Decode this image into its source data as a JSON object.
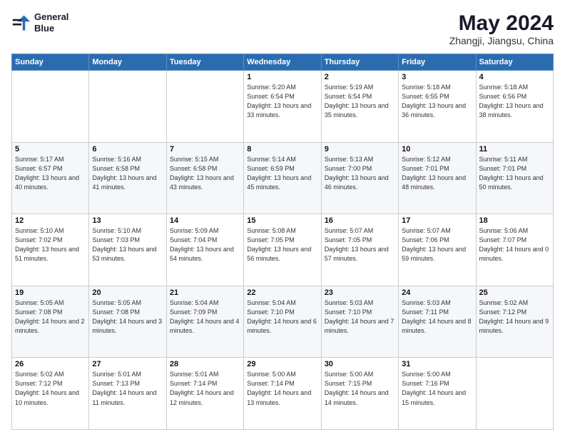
{
  "header": {
    "logo_line1": "General",
    "logo_line2": "Blue",
    "title": "May 2024",
    "subtitle": "Zhangji, Jiangsu, China"
  },
  "days_of_week": [
    "Sunday",
    "Monday",
    "Tuesday",
    "Wednesday",
    "Thursday",
    "Friday",
    "Saturday"
  ],
  "weeks": [
    [
      {
        "day": "",
        "info": ""
      },
      {
        "day": "",
        "info": ""
      },
      {
        "day": "",
        "info": ""
      },
      {
        "day": "1",
        "info": "Sunrise: 5:20 AM\nSunset: 6:54 PM\nDaylight: 13 hours and 33 minutes."
      },
      {
        "day": "2",
        "info": "Sunrise: 5:19 AM\nSunset: 6:54 PM\nDaylight: 13 hours and 35 minutes."
      },
      {
        "day": "3",
        "info": "Sunrise: 5:18 AM\nSunset: 6:55 PM\nDaylight: 13 hours and 36 minutes."
      },
      {
        "day": "4",
        "info": "Sunrise: 5:18 AM\nSunset: 6:56 PM\nDaylight: 13 hours and 38 minutes."
      }
    ],
    [
      {
        "day": "5",
        "info": "Sunrise: 5:17 AM\nSunset: 6:57 PM\nDaylight: 13 hours and 40 minutes."
      },
      {
        "day": "6",
        "info": "Sunrise: 5:16 AM\nSunset: 6:58 PM\nDaylight: 13 hours and 41 minutes."
      },
      {
        "day": "7",
        "info": "Sunrise: 5:15 AM\nSunset: 6:58 PM\nDaylight: 13 hours and 43 minutes."
      },
      {
        "day": "8",
        "info": "Sunrise: 5:14 AM\nSunset: 6:59 PM\nDaylight: 13 hours and 45 minutes."
      },
      {
        "day": "9",
        "info": "Sunrise: 5:13 AM\nSunset: 7:00 PM\nDaylight: 13 hours and 46 minutes."
      },
      {
        "day": "10",
        "info": "Sunrise: 5:12 AM\nSunset: 7:01 PM\nDaylight: 13 hours and 48 minutes."
      },
      {
        "day": "11",
        "info": "Sunrise: 5:11 AM\nSunset: 7:01 PM\nDaylight: 13 hours and 50 minutes."
      }
    ],
    [
      {
        "day": "12",
        "info": "Sunrise: 5:10 AM\nSunset: 7:02 PM\nDaylight: 13 hours and 51 minutes."
      },
      {
        "day": "13",
        "info": "Sunrise: 5:10 AM\nSunset: 7:03 PM\nDaylight: 13 hours and 53 minutes."
      },
      {
        "day": "14",
        "info": "Sunrise: 5:09 AM\nSunset: 7:04 PM\nDaylight: 13 hours and 54 minutes."
      },
      {
        "day": "15",
        "info": "Sunrise: 5:08 AM\nSunset: 7:05 PM\nDaylight: 13 hours and 56 minutes."
      },
      {
        "day": "16",
        "info": "Sunrise: 5:07 AM\nSunset: 7:05 PM\nDaylight: 13 hours and 57 minutes."
      },
      {
        "day": "17",
        "info": "Sunrise: 5:07 AM\nSunset: 7:06 PM\nDaylight: 13 hours and 59 minutes."
      },
      {
        "day": "18",
        "info": "Sunrise: 5:06 AM\nSunset: 7:07 PM\nDaylight: 14 hours and 0 minutes."
      }
    ],
    [
      {
        "day": "19",
        "info": "Sunrise: 5:05 AM\nSunset: 7:08 PM\nDaylight: 14 hours and 2 minutes."
      },
      {
        "day": "20",
        "info": "Sunrise: 5:05 AM\nSunset: 7:08 PM\nDaylight: 14 hours and 3 minutes."
      },
      {
        "day": "21",
        "info": "Sunrise: 5:04 AM\nSunset: 7:09 PM\nDaylight: 14 hours and 4 minutes."
      },
      {
        "day": "22",
        "info": "Sunrise: 5:04 AM\nSunset: 7:10 PM\nDaylight: 14 hours and 6 minutes."
      },
      {
        "day": "23",
        "info": "Sunrise: 5:03 AM\nSunset: 7:10 PM\nDaylight: 14 hours and 7 minutes."
      },
      {
        "day": "24",
        "info": "Sunrise: 5:03 AM\nSunset: 7:11 PM\nDaylight: 14 hours and 8 minutes."
      },
      {
        "day": "25",
        "info": "Sunrise: 5:02 AM\nSunset: 7:12 PM\nDaylight: 14 hours and 9 minutes."
      }
    ],
    [
      {
        "day": "26",
        "info": "Sunrise: 5:02 AM\nSunset: 7:12 PM\nDaylight: 14 hours and 10 minutes."
      },
      {
        "day": "27",
        "info": "Sunrise: 5:01 AM\nSunset: 7:13 PM\nDaylight: 14 hours and 11 minutes."
      },
      {
        "day": "28",
        "info": "Sunrise: 5:01 AM\nSunset: 7:14 PM\nDaylight: 14 hours and 12 minutes."
      },
      {
        "day": "29",
        "info": "Sunrise: 5:00 AM\nSunset: 7:14 PM\nDaylight: 14 hours and 13 minutes."
      },
      {
        "day": "30",
        "info": "Sunrise: 5:00 AM\nSunset: 7:15 PM\nDaylight: 14 hours and 14 minutes."
      },
      {
        "day": "31",
        "info": "Sunrise: 5:00 AM\nSunset: 7:16 PM\nDaylight: 14 hours and 15 minutes."
      },
      {
        "day": "",
        "info": ""
      }
    ]
  ]
}
